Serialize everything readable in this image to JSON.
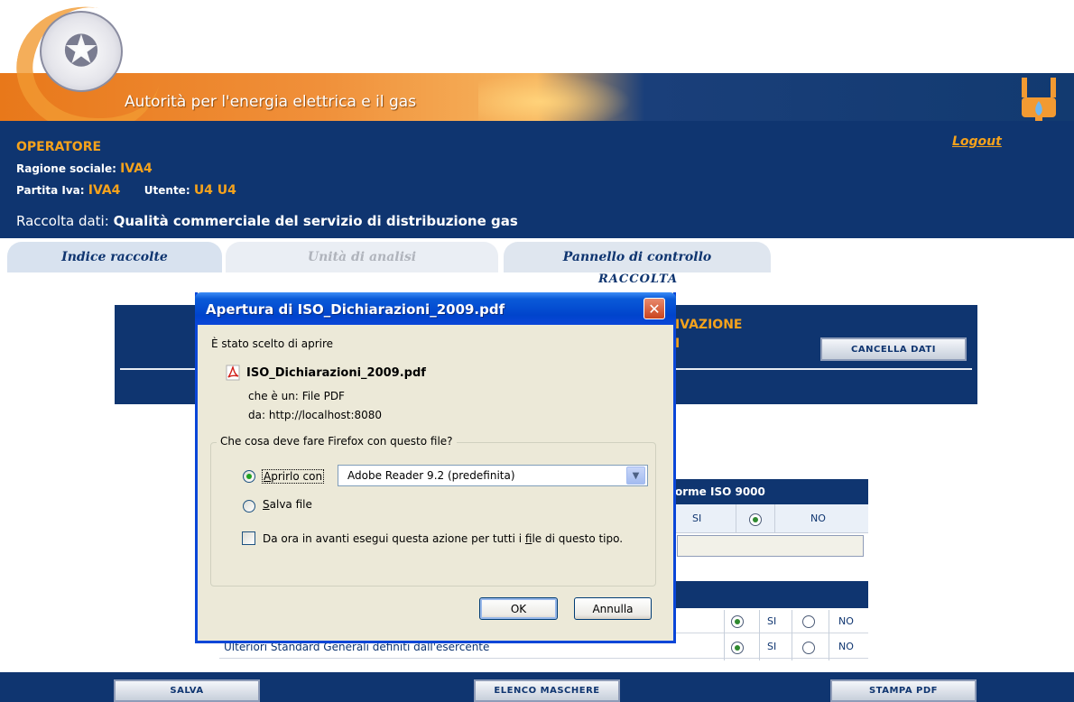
{
  "header": {
    "title": "Autorità per l'energia elettrica e il gas",
    "logout": "Logout"
  },
  "operator": {
    "title": "OPERATORE",
    "ragione_label": "Ragione sociale:",
    "ragione_value": "IVA4",
    "piva_label": "Partita Iva:",
    "piva_value": "IVA4",
    "utente_label": "Utente:",
    "utente_value": "U4 U4",
    "raccolta_label": "Raccolta dati:",
    "raccolta_value": "Qualità commerciale del servizio di distribuzione gas"
  },
  "tabs": [
    {
      "label": "Indice raccolte"
    },
    {
      "label": "Unità di analisi"
    },
    {
      "label": "Pannello di controllo"
    }
  ],
  "tab_sub": "RACCOLTA",
  "panel": {
    "text1": "IVAZIONE",
    "text2": "I",
    "cancella": "CANCELLA DATI"
  },
  "table": {
    "header": "orme ISO 9000",
    "si": "SI",
    "no": "NO",
    "rows": [
      {
        "label": "",
        "si": "SI",
        "no": "NO"
      },
      {
        "label": "Ulteriori Standard Generali definiti dall'esercente",
        "si": "SI",
        "no": "NO"
      }
    ]
  },
  "footer": {
    "salva": "SALVA",
    "elenco": "ELENCO MASCHERE",
    "stampa": "STAMPA PDF"
  },
  "dialog": {
    "title": "Apertura di ISO_Dichiarazioni_2009.pdf",
    "close": "✕",
    "intro": "È stato scelto di aprire",
    "filename": "ISO_Dichiarazioni_2009.pdf",
    "type_label": "che è un:",
    "type_value": "File PDF",
    "from_label": "da:",
    "from_value": "http://localhost:8080",
    "question": "Che cosa deve fare Firefox con questo file?",
    "open_with_prefix": "A",
    "open_with_rest": "prirlo con",
    "app_select": "Adobe Reader 9.2 (predefinita)",
    "save_prefix": "S",
    "save_rest": "alva file",
    "remember_a": "Da ora in avanti esegui questa azione per tutti i ",
    "remember_u": "f",
    "remember_b": "ile di questo tipo.",
    "ok": "OK",
    "cancel": "Annulla"
  }
}
